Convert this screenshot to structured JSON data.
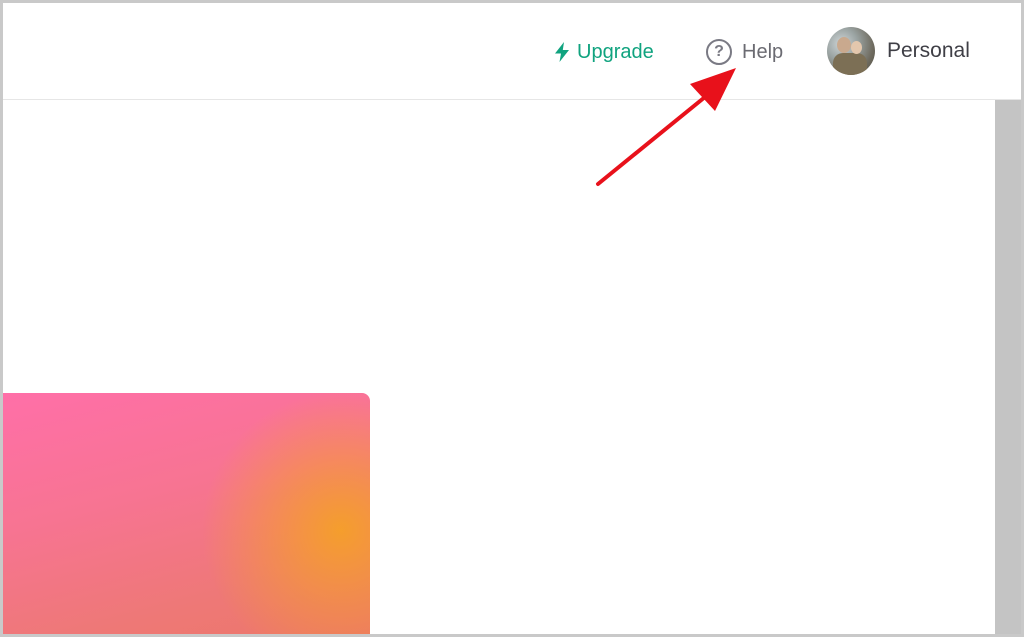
{
  "header": {
    "upgrade_label": "Upgrade",
    "help_label": "Help",
    "account_label": "Personal"
  },
  "icons": {
    "upgrade": "lightning-bolt-icon",
    "help": "question-circle-icon",
    "help_glyph": "?",
    "avatar": "user-avatar"
  },
  "colors": {
    "accent": "#10a37f",
    "help_text": "#6b6b72",
    "annotation_arrow": "#e8111b"
  }
}
